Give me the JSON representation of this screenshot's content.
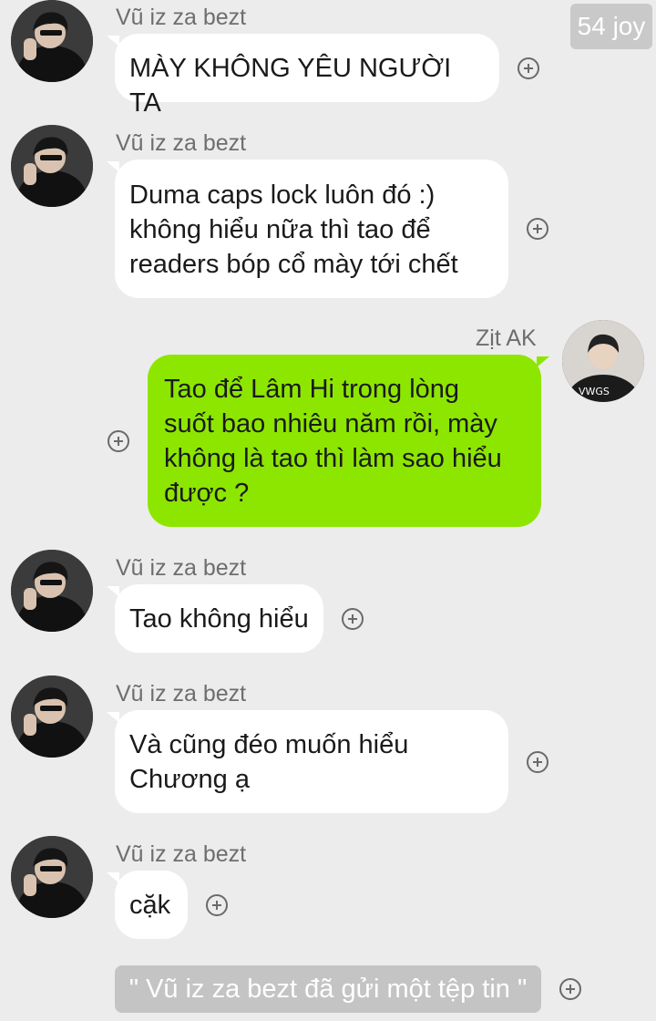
{
  "badge": {
    "text": "54 joy"
  },
  "messages": [
    {
      "sender": "Vũ iz za bezt",
      "text": "MÀY KHÔNG YÊU NGƯỜI TA",
      "direction": "incoming"
    },
    {
      "sender": "Vũ iz za bezt",
      "text": "Duma caps lock luôn đó :)\nkhông hiểu nữa thì tao để\nreaders bóp cổ mày tới chết",
      "direction": "incoming"
    },
    {
      "sender": "Zịt AK",
      "text": "Tao để Lâm Hi  trong lòng\nsuốt bao nhiêu năm rồi, mày\nkhông là tao thì làm sao hiểu\nđược ?",
      "direction": "outgoing"
    },
    {
      "sender": "Vũ iz za bezt",
      "text": "Tao không hiểu",
      "direction": "incoming"
    },
    {
      "sender": "Vũ iz za bezt",
      "text": "Và cũng đéo muốn hiểu\nChương ạ",
      "direction": "incoming"
    },
    {
      "sender": "Vũ iz za bezt",
      "text": "cặk",
      "direction": "incoming"
    }
  ],
  "file_notice": {
    "text": "\" Vũ iz za bezt đã gửi một tệp tin \""
  },
  "icons": {
    "reaction": "add-reaction-icon",
    "avatar": "user-avatar"
  },
  "colors": {
    "background": "#ececec",
    "incoming_bubble": "#ffffff",
    "outgoing_bubble": "#8de600",
    "badge": "#c9c9c9"
  }
}
